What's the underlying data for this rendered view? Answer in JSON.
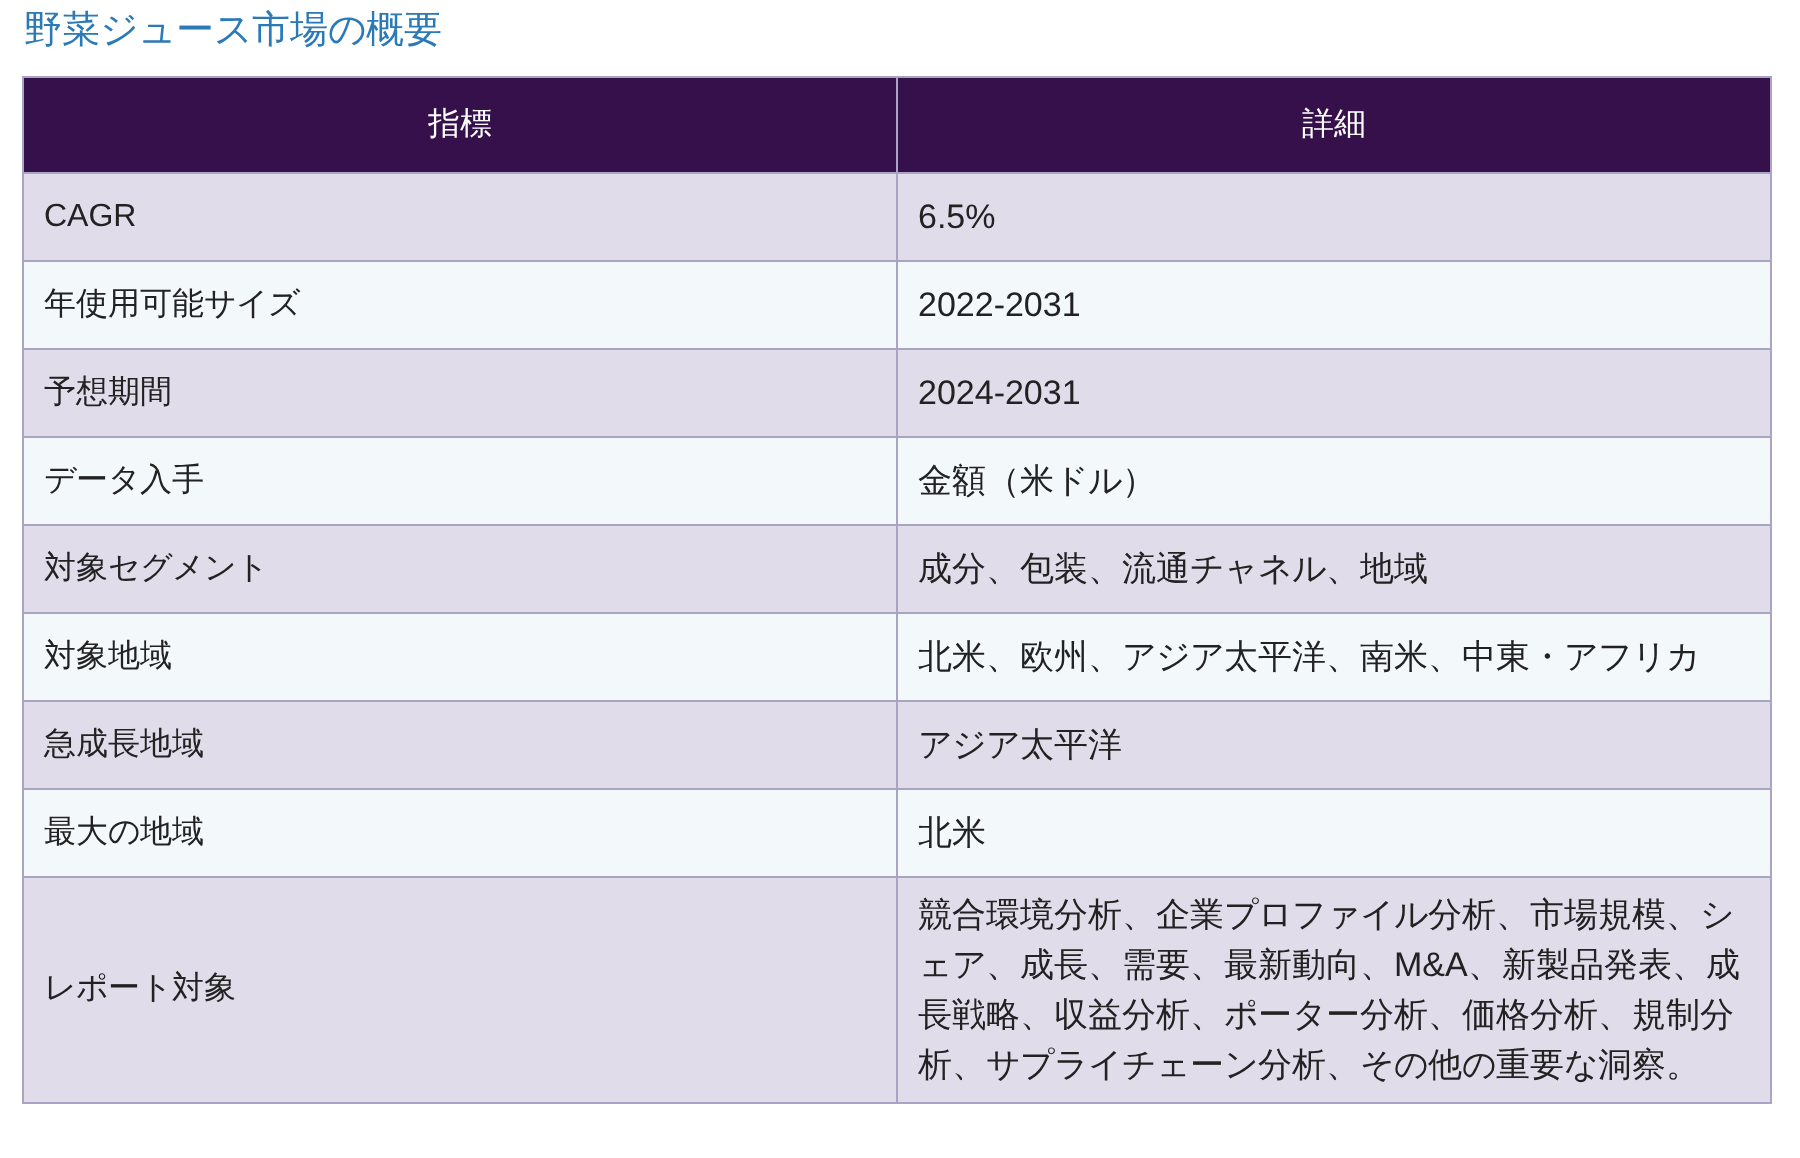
{
  "title": "野菜ジュース市場の概要",
  "table": {
    "columns": [
      "指標",
      "詳細"
    ],
    "rows": [
      [
        "CAGR",
        "6.5%"
      ],
      [
        "年使用可能サイズ",
        "2022-2031"
      ],
      [
        "予想期間",
        "2024-2031"
      ],
      [
        "データ入手",
        "金額（米ドル）"
      ],
      [
        "対象セグメント",
        "成分、包装、流通チャネル、地域"
      ],
      [
        "対象地域",
        "北米、欧州、アジア太平洋、南米、中東・アフリカ"
      ],
      [
        "急成長地域",
        "アジア太平洋"
      ],
      [
        "最大の地域",
        "北米"
      ],
      [
        "レポート対象",
        "競合環境分析、企業プロファイル分析、市場規模、シェア、成長、需要、最新動向、M&A、新製品発表、成長戦略、収益分析、ポーター分析、価格分析、規制分析、サプライチェーン分析、その他の重要な洞察。"
      ]
    ]
  }
}
